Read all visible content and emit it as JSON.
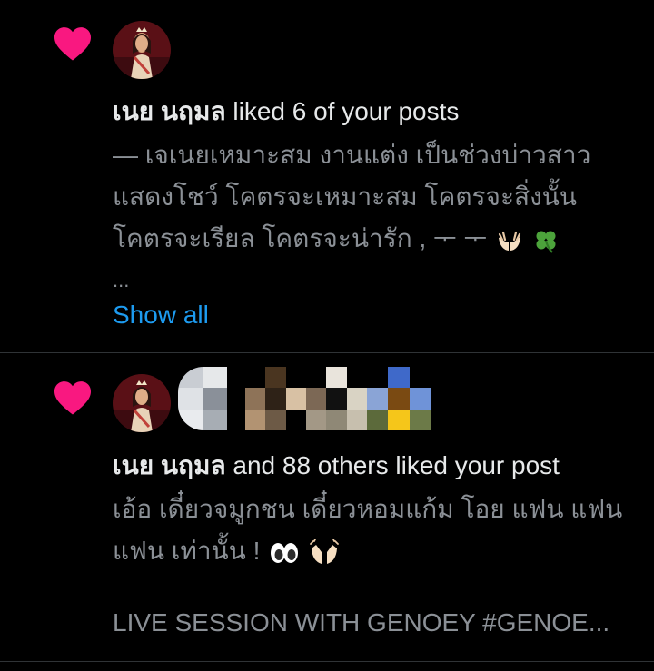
{
  "notifications": [
    {
      "type": "like",
      "icon": "heart-icon",
      "accent_color": "#f91880",
      "actor_name": "เนย นฤมล",
      "action_text": "liked 6 of your posts",
      "post_lines": [
        "— เจเนยเหมาะสม งานแต่ง เป็นช่วงบ่าวสาว",
        "แสดงโชว์ โคตรจะเหมาะสม โคตรจะสิ่งนั้น",
        "โคตรจะเรียล โคตรจะน่ารัก , ᅮ ᅮ"
      ],
      "post_line_emojis": [
        "palms-up-together",
        "four-leaf-clover"
      ],
      "ellipsis": "...",
      "show_all_label": "Show all",
      "link_color": "#1d9bf0"
    },
    {
      "type": "like",
      "icon": "heart-icon",
      "accent_color": "#f91880",
      "actor_name": "เนย นฤมล",
      "action_text": "and 88 others liked your post",
      "post_lines": [
        "เอ้อ เดี๋ยวจมูกชน เดี๋ยวหอมแก้ม โอย แฟน แฟน",
        "แฟน เท่านั้น !"
      ],
      "post_line_emojis": [
        "eyes",
        "raising-hands"
      ],
      "preview_text": "LIVE SESSION WITH GENOEY #GENOE..."
    }
  ]
}
